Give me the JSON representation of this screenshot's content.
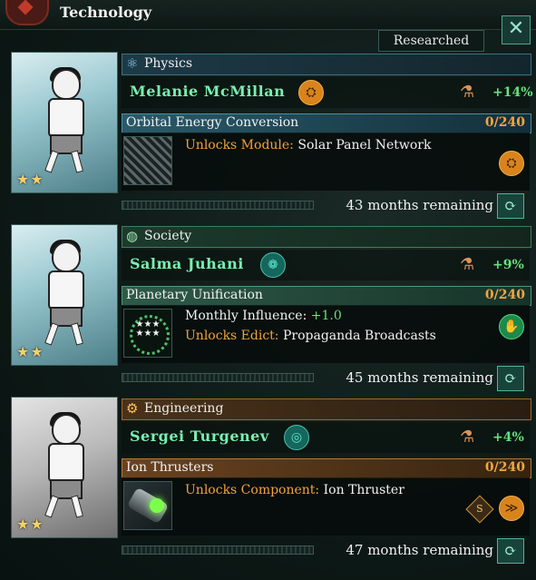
{
  "window": {
    "title": "Technology",
    "researched_label": "Researched",
    "close_glyph": "✕"
  },
  "slots": [
    {
      "category": "Physics",
      "category_icon": "atom-icon",
      "scientist": {
        "name": "Melanie McMillan",
        "stars": "★★",
        "trait_icon": "factory-icon",
        "trait_glyph": "⛭",
        "bonus": "+14%"
      },
      "tech": {
        "name": "Orbital Energy Conversion",
        "progress": "0/240",
        "lines": [
          {
            "key": "Unlocks Module:",
            "value": "Solar Panel Network"
          }
        ],
        "badge_icon": "factory-icon",
        "badge_glyph": "⛭"
      },
      "months_remaining": "43 months remaining"
    },
    {
      "category": "Society",
      "category_icon": "globe-icon",
      "scientist": {
        "name": "Salma Juhani",
        "stars": "★★",
        "trait_icon": "brain-icon",
        "trait_glyph": "❁",
        "bonus": "+9%"
      },
      "tech": {
        "name": "Planetary Unification",
        "progress": "0/240",
        "lines": [
          {
            "key": "Monthly Influence:",
            "value": "+1.0"
          },
          {
            "key": "Unlocks Edict:",
            "value": "Propaganda Broadcasts"
          }
        ],
        "badge_icon": "handshake-icon",
        "badge_glyph": "✋"
      },
      "months_remaining": "45 months remaining"
    },
    {
      "category": "Engineering",
      "category_icon": "gear-icon",
      "scientist": {
        "name": "Sergei Turgenev",
        "stars": "★★",
        "trait_icon": "spiral-icon",
        "trait_glyph": "◎",
        "bonus": "+4%"
      },
      "tech": {
        "name": "Ion Thrusters",
        "progress": "0/240",
        "lines": [
          {
            "key": "Unlocks Component:",
            "value": "Ion Thruster"
          }
        ],
        "small_badge": "S",
        "badge_icon": "thruster-icon",
        "badge_glyph": "≫"
      },
      "months_remaining": "47 months remaining"
    }
  ],
  "flask_glyph": "⚗",
  "cycle_glyph": "⟳"
}
